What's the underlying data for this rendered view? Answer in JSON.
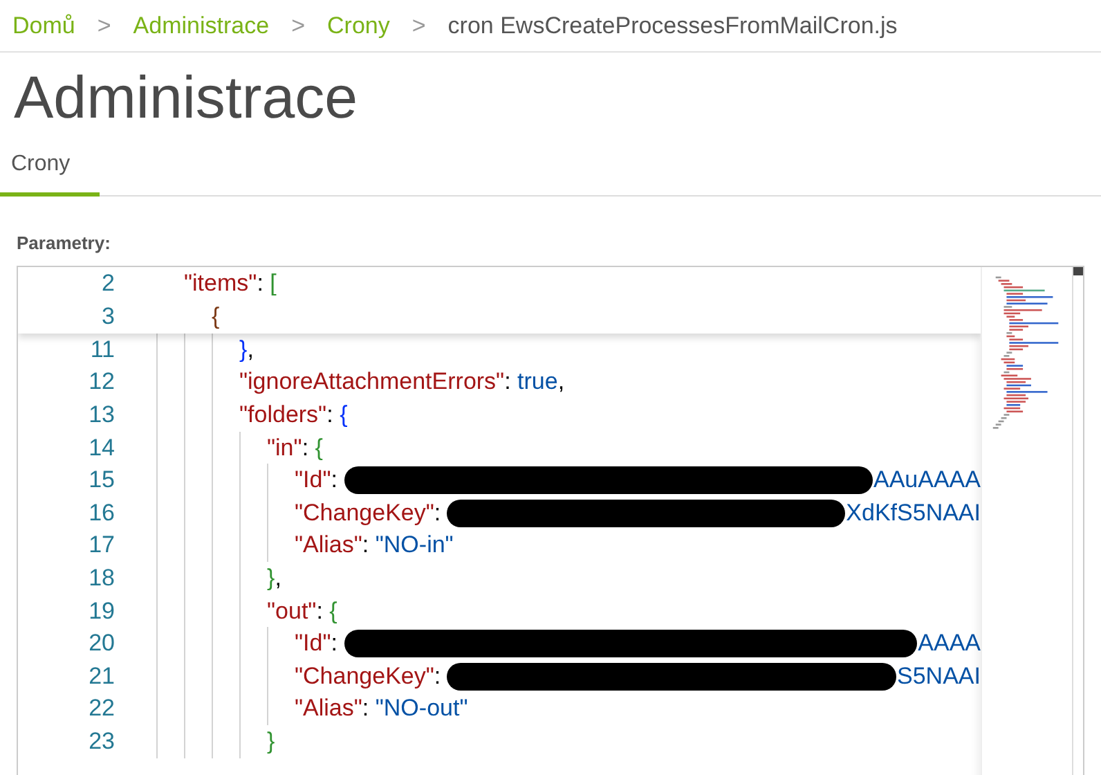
{
  "breadcrumb": [
    {
      "label": "Domů",
      "link": true
    },
    {
      "label": "Administrace",
      "link": true
    },
    {
      "label": "Crony",
      "link": true
    },
    {
      "label": "cron EwsCreateProcessesFromMailCron.js",
      "link": false
    }
  ],
  "breadcrumb_separator": ">",
  "page_title": "Administrace",
  "tabs": [
    {
      "label": "Crony",
      "selected": true
    }
  ],
  "editor": {
    "label": "Parametry:",
    "sticky_lines": [
      {
        "number": "2",
        "tokens": [
          {
            "kind": "key",
            "text": "\"items\""
          },
          {
            "kind": "punct",
            "text": ": "
          },
          {
            "kind": "bracket",
            "text": "[",
            "color": "#319331"
          }
        ],
        "children": [
          {
            "number": "3",
            "tokens": [
              {
                "kind": "bracket",
                "text": "{",
                "color": "#7b3814"
              }
            ]
          }
        ]
      }
    ],
    "lines": [
      {
        "number": "11",
        "tokens": [
          {
            "kind": "bracket",
            "text": "}",
            "color": "#0431fa"
          },
          {
            "kind": "punct",
            "text": ","
          }
        ]
      },
      {
        "number": "12",
        "tokens": [
          {
            "kind": "key",
            "text": "\"ignoreAttachmentErrors\""
          },
          {
            "kind": "punct",
            "text": ": "
          },
          {
            "kind": "literal",
            "text": "true"
          },
          {
            "kind": "punct",
            "text": ","
          }
        ]
      },
      {
        "number": "13",
        "tokens": [
          {
            "kind": "key",
            "text": "\"folders\""
          },
          {
            "kind": "punct",
            "text": ": "
          },
          {
            "kind": "bracket",
            "text": "{",
            "color": "#0431fa"
          }
        ],
        "children": [
          {
            "number": "14",
            "tokens": [
              {
                "kind": "key",
                "text": "\"in\""
              },
              {
                "kind": "punct",
                "text": ": "
              },
              {
                "kind": "bracket",
                "text": "{",
                "color": "#319331"
              }
            ],
            "children": [
              {
                "number": "15",
                "tokens": [
                  {
                    "kind": "key",
                    "text": "\"Id\""
                  },
                  {
                    "kind": "punct",
                    "text": ": "
                  },
                  {
                    "kind": "redaction"
                  },
                  {
                    "kind": "string",
                    "text": "AAuAAAA"
                  }
                ]
              },
              {
                "number": "16",
                "tokens": [
                  {
                    "kind": "key",
                    "text": "\"ChangeKey\""
                  },
                  {
                    "kind": "punct",
                    "text": ": "
                  },
                  {
                    "kind": "redaction"
                  },
                  {
                    "kind": "string",
                    "text": "XdKfS5NAAI"
                  }
                ]
              },
              {
                "number": "17",
                "tokens": [
                  {
                    "kind": "key",
                    "text": "\"Alias\""
                  },
                  {
                    "kind": "punct",
                    "text": ": "
                  },
                  {
                    "kind": "string",
                    "text": "\"NO-in\""
                  }
                ]
              }
            ]
          },
          {
            "number": "18",
            "tokens": [
              {
                "kind": "bracket",
                "text": "}",
                "color": "#319331"
              },
              {
                "kind": "punct",
                "text": ","
              }
            ]
          },
          {
            "number": "19",
            "tokens": [
              {
                "kind": "key",
                "text": "\"out\""
              },
              {
                "kind": "punct",
                "text": ": "
              },
              {
                "kind": "bracket",
                "text": "{",
                "color": "#319331"
              }
            ],
            "children": [
              {
                "number": "20",
                "tokens": [
                  {
                    "kind": "key",
                    "text": "\"Id\""
                  },
                  {
                    "kind": "punct",
                    "text": ": "
                  },
                  {
                    "kind": "redaction"
                  },
                  {
                    "kind": "string",
                    "text": "AAAA"
                  }
                ]
              },
              {
                "number": "21",
                "tokens": [
                  {
                    "kind": "key",
                    "text": "\"ChangeKey\""
                  },
                  {
                    "kind": "punct",
                    "text": ": "
                  },
                  {
                    "kind": "redaction"
                  },
                  {
                    "kind": "string",
                    "text": "S5NAAI"
                  }
                ]
              },
              {
                "number": "22",
                "tokens": [
                  {
                    "kind": "key",
                    "text": "\"Alias\""
                  },
                  {
                    "kind": "punct",
                    "text": ": "
                  },
                  {
                    "kind": "string",
                    "text": "\"NO-out\""
                  }
                ]
              }
            ]
          },
          {
            "number": "23",
            "tokens": [
              {
                "kind": "bracket",
                "text": "}",
                "color": "#319331"
              }
            ]
          }
        ]
      }
    ]
  }
}
